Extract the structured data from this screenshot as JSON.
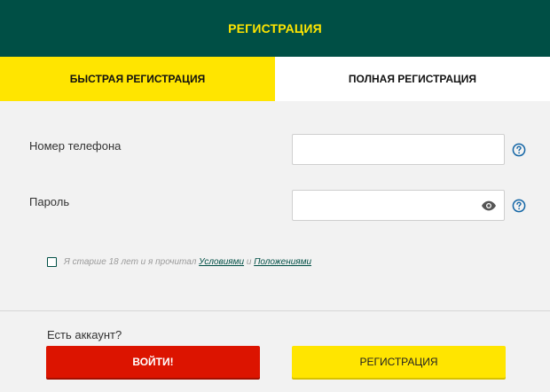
{
  "header": {
    "title": "РЕГИСТРАЦИЯ"
  },
  "tabs": [
    {
      "label": "БЫСТРАЯ РЕГИСТРАЦИЯ",
      "active": true
    },
    {
      "label": "ПОЛНАЯ РЕГИСТРАЦИЯ",
      "active": false
    }
  ],
  "form": {
    "phone": {
      "label": "Номер телефона",
      "value": "",
      "placeholder": ""
    },
    "password": {
      "label": "Пароль",
      "value": "",
      "placeholder": ""
    },
    "agree": {
      "checked": false,
      "prefix": "Я старше 18 лет и я прочитал ",
      "link1": "Условиями",
      "middle": " и ",
      "link2": "Положениями"
    }
  },
  "footer": {
    "have_account": "Есть аккаунт?",
    "login_label": "ВОЙТИ!",
    "register_label": "РЕГИСТРАЦИЯ"
  },
  "icons": {
    "help": "question-circle-icon",
    "eye": "eye-icon"
  },
  "colors": {
    "header_bg": "#004f45",
    "accent_yellow": "#ffe500",
    "login_red": "#dc1400",
    "help_blue": "#1466a6"
  }
}
